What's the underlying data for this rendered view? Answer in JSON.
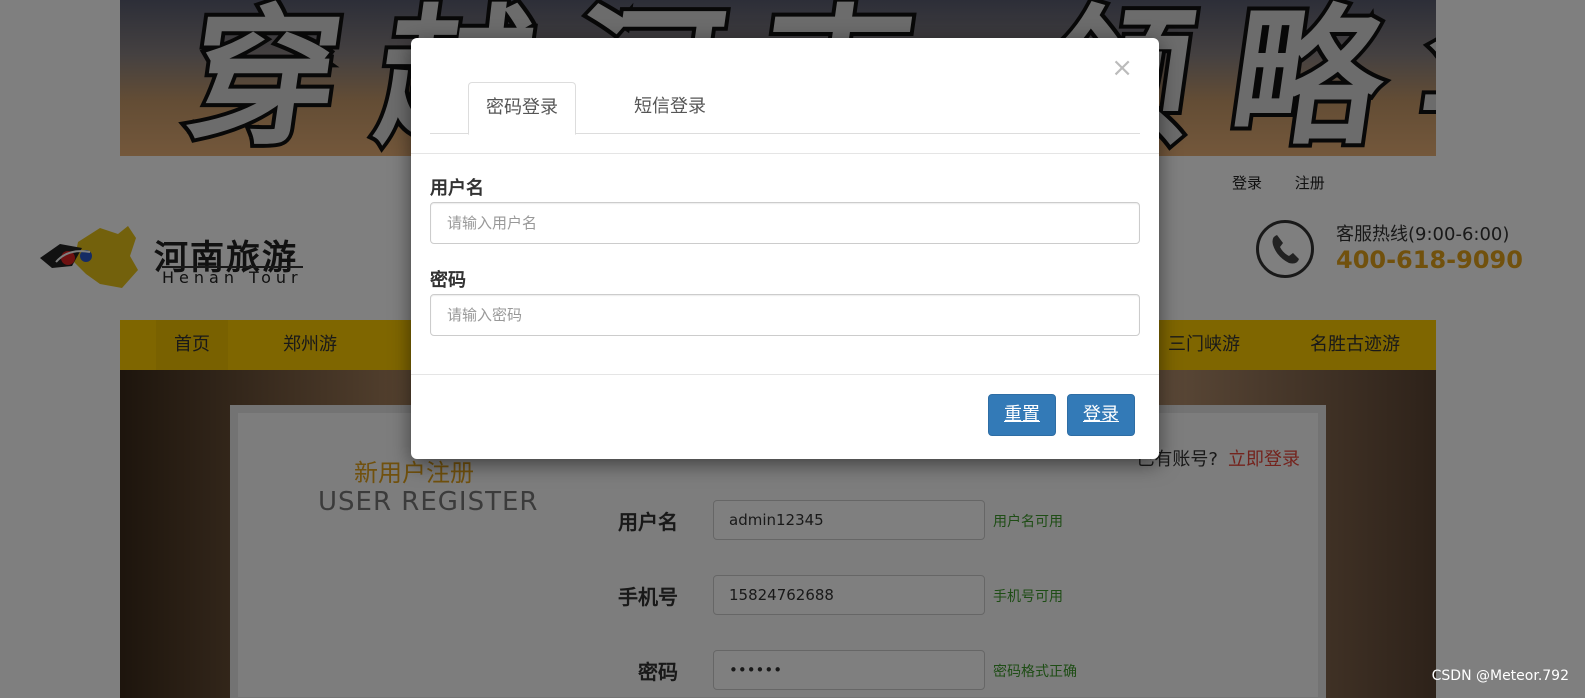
{
  "banner": {
    "text": "穿越河南·领略华夏"
  },
  "top_links": {
    "login": "登录",
    "register": "注册"
  },
  "logo": {
    "cn": "河南旅游",
    "en": "Henan Tour"
  },
  "hotline": {
    "label": "客服热线(9:00-6:00)",
    "number": "400-618-9090"
  },
  "nav": {
    "items": [
      {
        "label": "首页"
      },
      {
        "label": "郑州游"
      },
      {
        "label": "三门峡游"
      },
      {
        "label": "名胜古迹游"
      }
    ]
  },
  "register": {
    "title_cn": "新用户注册",
    "title_en": "USER REGISTER",
    "have_account": "已有账号?",
    "login_link": "立即登录",
    "fields": [
      {
        "label": "用户名",
        "value": "admin12345",
        "hint": "用户名可用"
      },
      {
        "label": "手机号",
        "value": "15824762688",
        "hint": "手机号可用"
      },
      {
        "label": "密码",
        "value": "••••••",
        "hint": "密码格式正确"
      }
    ]
  },
  "modal": {
    "close": "×",
    "tabs": [
      {
        "label": "密码登录",
        "active": true
      },
      {
        "label": "短信登录",
        "active": false
      }
    ],
    "username_label": "用户名",
    "username_placeholder": "请输入用户名",
    "password_label": "密码",
    "password_placeholder": "请输入密码",
    "reset_label": "重置",
    "login_label": "登录"
  },
  "watermark": "CSDN @Meteor.792",
  "colors": {
    "accent": "#ffcc00",
    "primary_button": "#337ab7",
    "hotline": "#e3a21a",
    "valid_hint": "#3c9a2a",
    "login_link": "#e8473b"
  }
}
